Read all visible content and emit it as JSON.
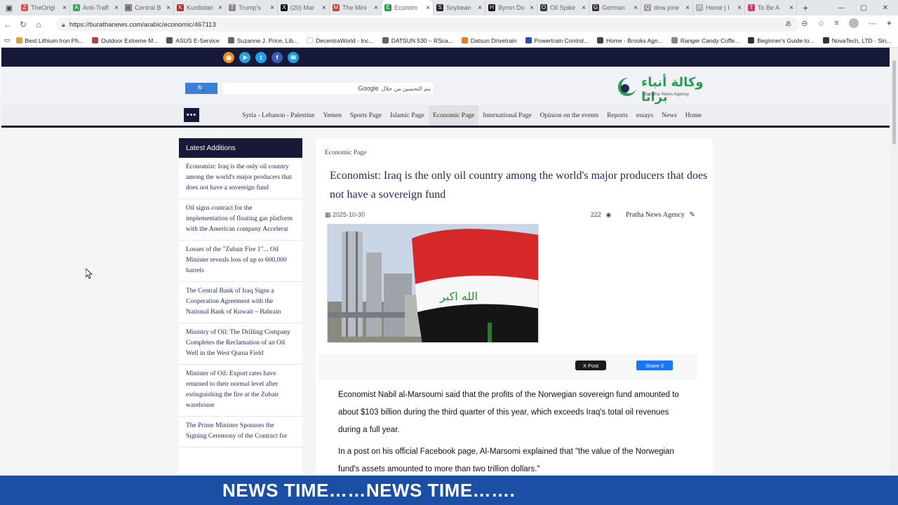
{
  "browser": {
    "tabs": [
      {
        "title": "TheOrigi",
        "color": "#e05050",
        "glyph": "Z"
      },
      {
        "title": "Anti-Traff",
        "color": "#3aa35a",
        "glyph": "A"
      },
      {
        "title": "Central B",
        "color": "#666666",
        "glyph": "◯"
      },
      {
        "title": "Kurdistan",
        "color": "#b03030",
        "glyph": "K"
      },
      {
        "title": "Trump's",
        "color": "#888888",
        "glyph": "T"
      },
      {
        "title": "(20) Mar",
        "color": "#111111",
        "glyph": "X"
      },
      {
        "title": "The Mini",
        "color": "#c04040",
        "glyph": "M"
      },
      {
        "title": "Econom",
        "color": "#2f9a55",
        "glyph": "E",
        "active": true
      },
      {
        "title": "Soybean",
        "color": "#222222",
        "glyph": "S"
      },
      {
        "title": "Byron Do",
        "color": "#111111",
        "glyph": "H"
      },
      {
        "title": "Oil Spike",
        "color": "#333333",
        "glyph": "O"
      },
      {
        "title": "German",
        "color": "#333333",
        "glyph": "G"
      },
      {
        "title": "dow jone",
        "color": "#999999",
        "glyph": "Q"
      },
      {
        "title": "Home | I",
        "color": "#aaaaaa",
        "glyph": "H"
      },
      {
        "title": "To Be A",
        "color": "#d04060",
        "glyph": "T"
      }
    ],
    "url": "https://burathanews.com/arabic/economic/467113",
    "bookmarks": [
      {
        "label": "Best Lithium Iron Ph...",
        "color": "#e0a030"
      },
      {
        "label": "Outdoor Extreme M...",
        "color": "#c04040"
      },
      {
        "label": "ASUS E-Service",
        "color": "#555555"
      },
      {
        "label": "Suzanne J. Price, Lib...",
        "color": "#666666"
      },
      {
        "label": "DecentraWorld - Inc...",
        "color": "#ffffff"
      },
      {
        "label": "DATSUN 530 – RSca...",
        "color": "#666666"
      },
      {
        "label": "Datsun Drivetrain",
        "color": "#e08020"
      },
      {
        "label": "Powertrain Control...",
        "color": "#2050c0"
      },
      {
        "label": "Home - Brooks Agn...",
        "color": "#444444"
      },
      {
        "label": "Ranger Candy Coffe...",
        "color": "#888888"
      },
      {
        "label": "Beginner's Guide to...",
        "color": "#333333"
      },
      {
        "label": "NovaTech, LTD - Sin...",
        "color": "#333333"
      }
    ]
  },
  "site": {
    "search_button": "🔍",
    "search_hint": "يتم التحسين من خلال",
    "search_brand": "Google",
    "logo_ar": "وكالة أنباء براثا",
    "logo_en": "Buratha News Agency",
    "nav": [
      "Syria - Lebanon - Palestine",
      "Yemen",
      "Sports Page",
      "Islamic Page",
      "Economic Page",
      "International Page",
      "Opinion on the events",
      "Reports",
      "essays",
      "News",
      "Home"
    ],
    "nav_active": "Economic Page",
    "more_label": "•••"
  },
  "sidebar": {
    "title": "Latest Additions",
    "items": [
      "Economist: Iraq is the only oil country among the world's major producers that does not have a sovereign fund",
      "Oil signs contract for the implementation of floating gas platform with the American company Accelerat",
      "Losses of the \"Zubair Fire 1\"... Oil Minister reveals loss of up to 600,000 barrels",
      "The Central Bank of Iraq Signs a Cooperation Agreement with the National Bank of Kuwait – Bahrain",
      "Ministry of Oil: The Drilling Company Completes the Reclamation of an Oil Well in the West Qurna Field",
      "Minister of Oil: Export rates have returned to their normal level after extinguishing the fire at the Zubair warehouse",
      "The Prime Minister Sponsors the Signing Ceremony of the Contract for"
    ]
  },
  "article": {
    "breadcrumb": "Economic Page",
    "headline": "Economist: Iraq is the only oil country among the world's major producers that does not have a sovereign fund",
    "date": "2025-10-30",
    "views": "222",
    "source": "Pratha News Agency",
    "share_x": "X Post",
    "share_fb": "Share 0",
    "paragraphs": [
      "Economist Nabil al-Marsoumi said that the profits of the Norwegian sovereign fund amounted to about $103 billion during the third quarter of this year, which exceeds Iraq's total oil revenues during a full year.",
      "In a post on his official Facebook page, Al-Marsomi explained that \"the value of the Norwegian fund's assets amounted to more than two trillion dollars.\""
    ]
  },
  "ticker": {
    "text": "NEWS TIME……NEWS TIME……."
  }
}
